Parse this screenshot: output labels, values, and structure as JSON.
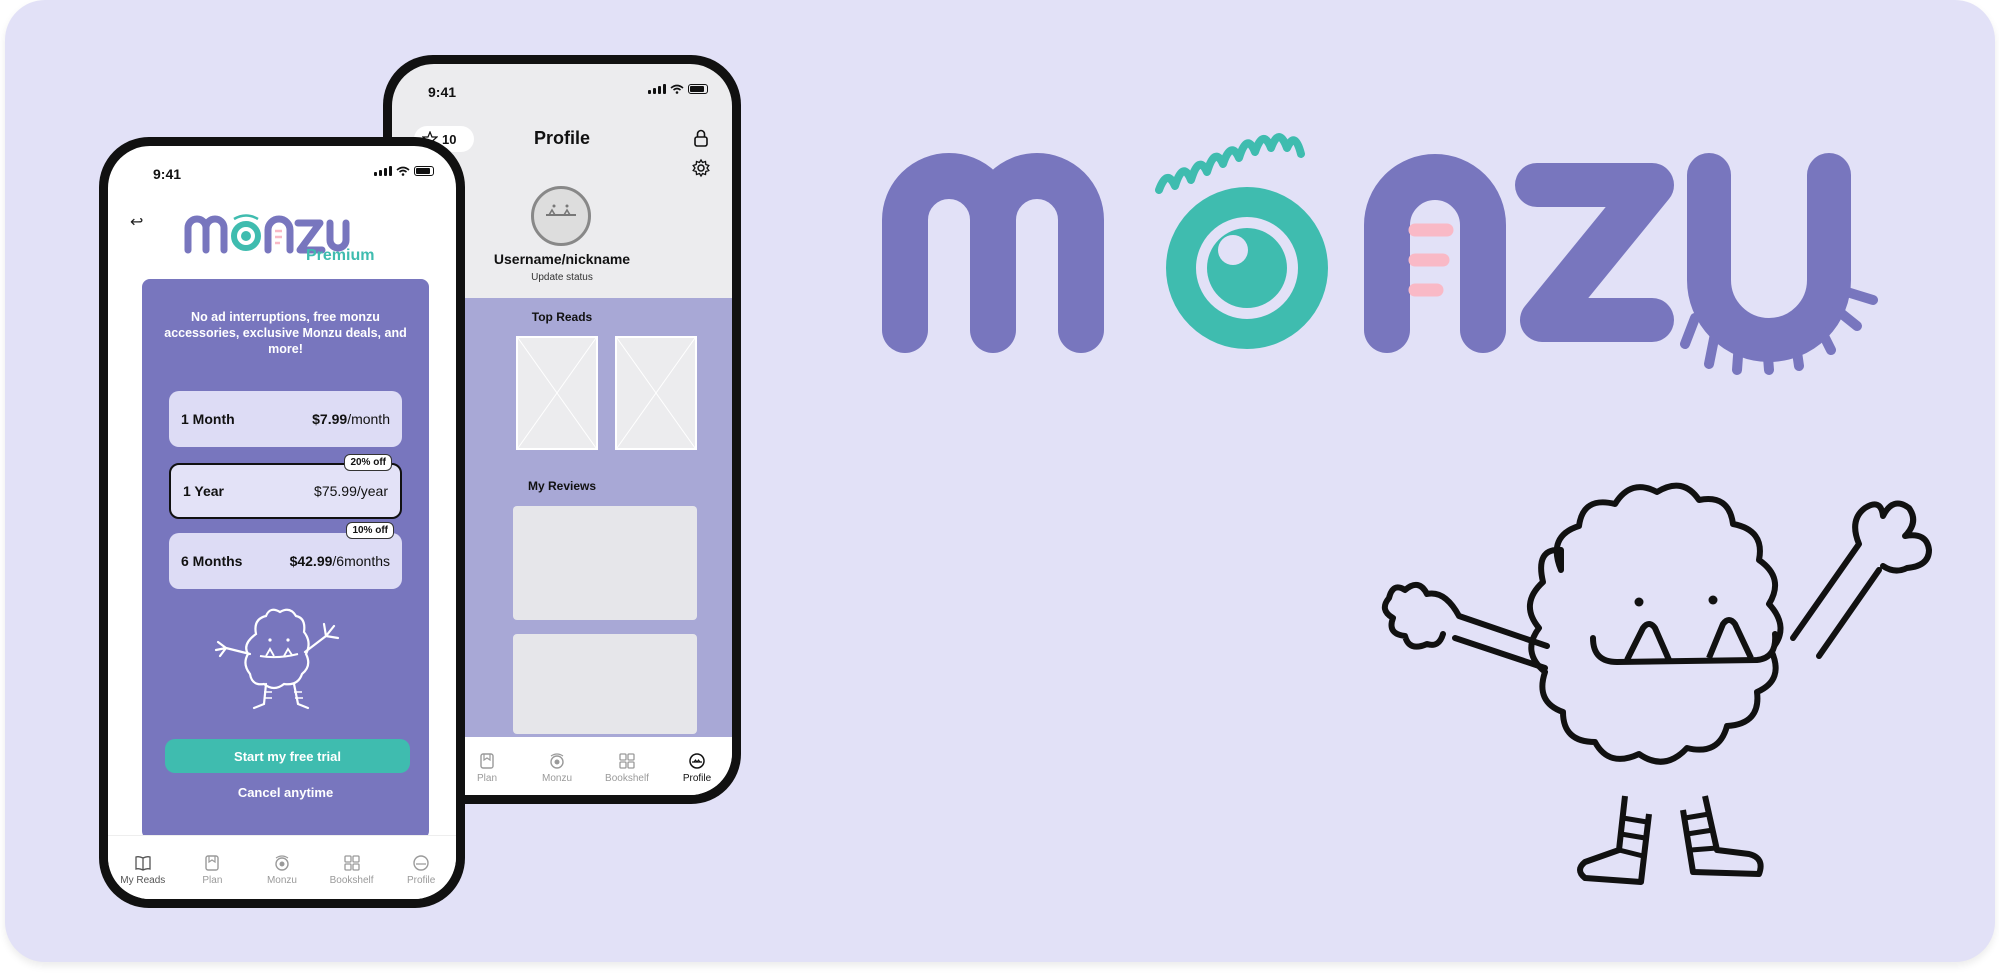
{
  "brand": {
    "logo_text": "MONZU",
    "colors": {
      "purple": "#7876be",
      "teal": "#3fbcaf",
      "pink": "#f9b9c6",
      "background": "#e2e1f7"
    }
  },
  "profile_screen": {
    "status_time": "9:41",
    "coins": "10",
    "title": "Profile",
    "icons": [
      "star-icon",
      "lock-icon",
      "gear-icon"
    ],
    "username": "Username/nickname",
    "status_text": "Update status",
    "top_reads_title": "Top Reads",
    "my_reviews_title": "My Reviews",
    "tabs": [
      {
        "label": "Plan",
        "icon": "plan-icon"
      },
      {
        "label": "Monzu",
        "icon": "monzu-eye-icon"
      },
      {
        "label": "Bookshelf",
        "icon": "bookshelf-icon"
      },
      {
        "label": "Profile",
        "icon": "profile-icon",
        "active": true
      }
    ]
  },
  "premium_screen": {
    "status_time": "9:41",
    "logo_text": "monzu",
    "premium_label": "Premium",
    "description": "No ad interruptions, free monzu accessories, exclusive Monzu deals, and more!",
    "plans": [
      {
        "name": "1 Month",
        "price": "$7.99",
        "unit": "/month",
        "badge": ""
      },
      {
        "name": "1 Year",
        "price": "$75.99",
        "unit": "/year",
        "badge": "20% off",
        "selected": true
      },
      {
        "name": "6 Months",
        "price": "$42.99",
        "unit": "/6months",
        "badge": "10% off"
      }
    ],
    "cta_label": "Start my free trial",
    "cancel_label": "Cancel anytime",
    "tabs": [
      {
        "label": "My Reads",
        "icon": "book-icon",
        "active": true
      },
      {
        "label": "Plan",
        "icon": "plan-icon"
      },
      {
        "label": "Monzu",
        "icon": "monzu-eye-icon"
      },
      {
        "label": "Bookshelf",
        "icon": "bookshelf-icon"
      },
      {
        "label": "Profile",
        "icon": "profile-icon"
      }
    ]
  }
}
